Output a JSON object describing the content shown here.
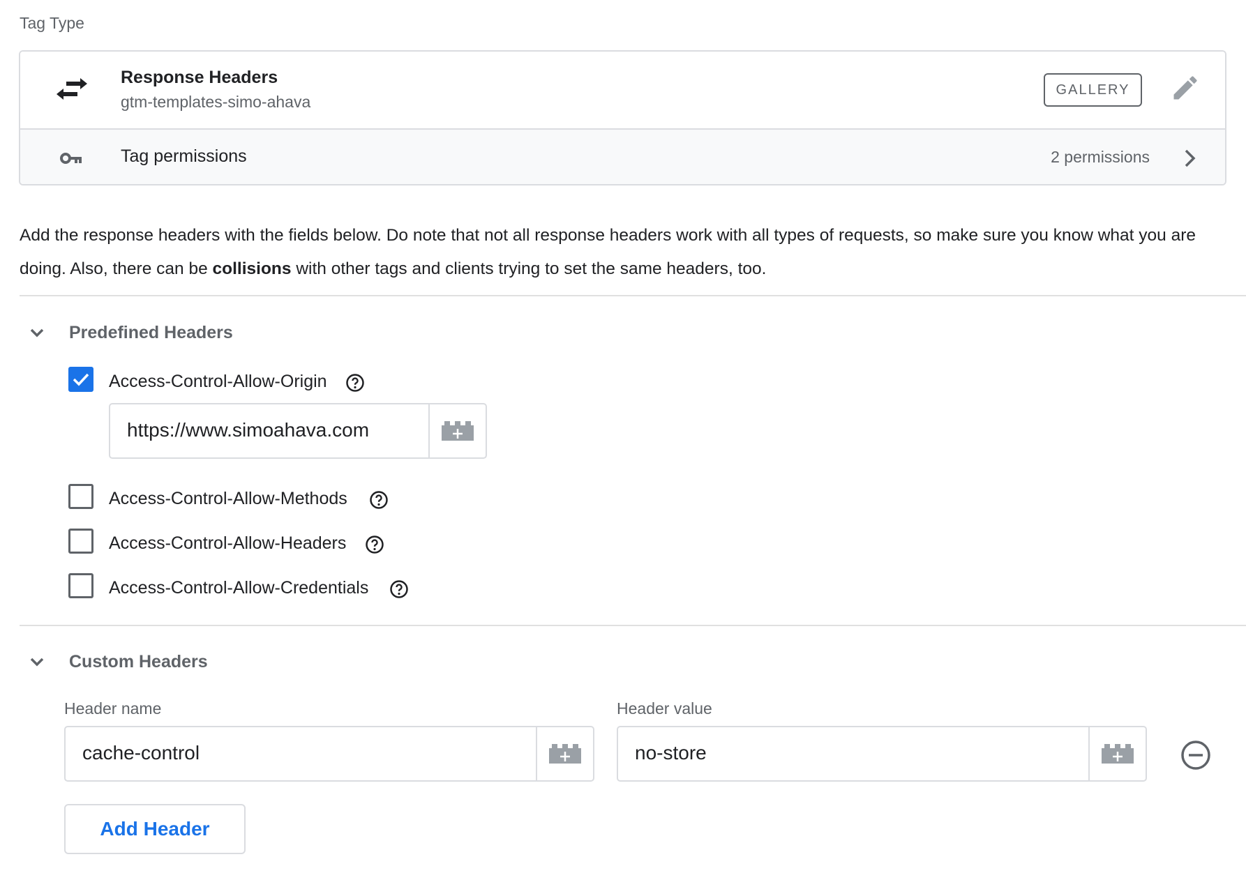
{
  "section_label": "Tag Type",
  "template": {
    "name": "Response Headers",
    "author": "gtm-templates-simo-ahava",
    "badge": "GALLERY",
    "permissions_label": "Tag permissions",
    "permissions_count": "2 permissions"
  },
  "description": {
    "part1": "Add the response headers with the fields below. Do note that not all response headers work with all types of requests, so make sure you know what you are doing. Also, there can be ",
    "bold": "collisions",
    "part2": " with other tags and clients trying to set the same headers, too."
  },
  "predefined": {
    "title": "Predefined Headers",
    "items": [
      {
        "label": "Access-Control-Allow-Origin",
        "checked": true,
        "value": "https://www.simoahava.com"
      },
      {
        "label": "Access-Control-Allow-Methods",
        "checked": false
      },
      {
        "label": "Access-Control-Allow-Headers",
        "checked": false
      },
      {
        "label": "Access-Control-Allow-Credentials",
        "checked": false
      }
    ]
  },
  "custom": {
    "title": "Custom Headers",
    "name_caption": "Header name",
    "value_caption": "Header value",
    "rows": [
      {
        "name": "cache-control",
        "value": "no-store"
      }
    ],
    "add_button": "Add Header"
  },
  "colors": {
    "accent": "#1a73e8",
    "text": "#202124",
    "secondary_text": "#5f6368",
    "border": "#dadce0"
  },
  "icons": {
    "template": "swap-arrows-icon",
    "edit": "pencil-icon",
    "permissions": "key-icon",
    "open": "chevron-right-icon",
    "collapse": "chevron-down-icon",
    "help": "help-circle-icon",
    "variable": "variable-brick-icon",
    "remove": "remove-circle-icon"
  }
}
